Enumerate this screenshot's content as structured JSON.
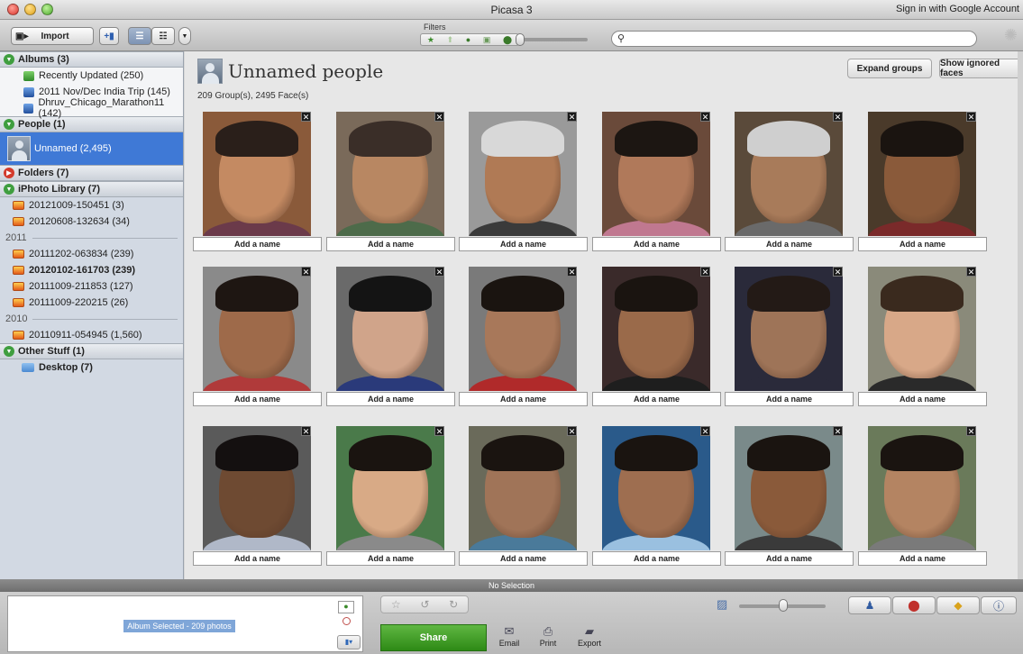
{
  "window": {
    "title": "Picasa 3",
    "signin": "Sign in with Google Account"
  },
  "toolbar": {
    "import_label": "Import",
    "filters_label": "Filters"
  },
  "search": {
    "placeholder": ""
  },
  "sidebar": {
    "albums_head": "Albums (3)",
    "albums": [
      {
        "label": "Recently Updated (250)",
        "color": "#3e9a3e"
      },
      {
        "label": "2011 Nov/Dec India Trip (145)",
        "color": "#2f68b8"
      },
      {
        "label": "Dhruv_Chicago_Marathon11 (142)",
        "color": "#2f68b8"
      }
    ],
    "people_head": "People (1)",
    "people_selected": "Unnamed (2,495)",
    "folders_head": "Folders (7)",
    "iphoto_head": "iPhoto Library (7)",
    "iphoto_top": [
      "20121009-150451 (3)",
      "20120608-132634 (34)"
    ],
    "year_2011": "2011",
    "iphoto_2011": [
      "20111202-063834 (239)",
      "20120102-161703 (239)",
      "20111009-211853 (127)",
      "20111009-220215 (26)"
    ],
    "year_2010": "2010",
    "iphoto_2010": [
      "20110911-054945 (1,560)"
    ],
    "other_head": "Other Stuff (1)",
    "other_items": [
      "Desktop (7)"
    ]
  },
  "main": {
    "title": "Unnamed people",
    "subtitle": "209 Group(s), 2495 Face(s)",
    "expand_groups": "Expand groups",
    "show_ignored": "Show ignored faces",
    "add_name_label": "Add a name",
    "close_glyph": "✕"
  },
  "status": {
    "text": "No Selection"
  },
  "bottom": {
    "tray_label": "Album Selected - 209 photos",
    "share": "Share",
    "email": "Email",
    "print": "Print",
    "export": "Export"
  },
  "colors": {
    "accent_selection": "#3f79d6",
    "share_green": "#3a9d22"
  }
}
